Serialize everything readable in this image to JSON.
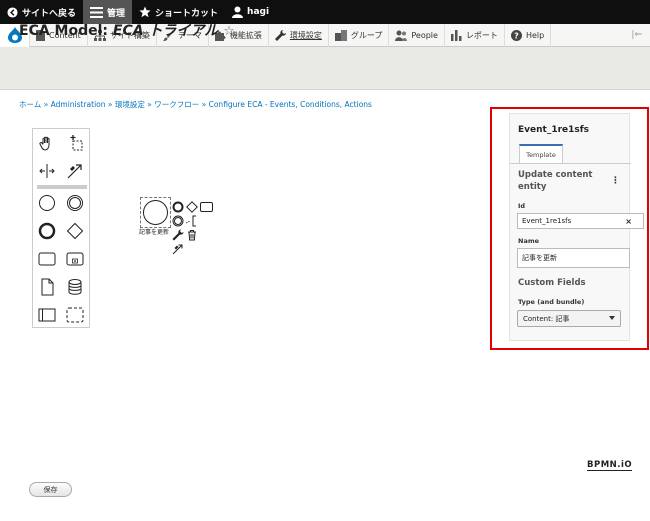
{
  "topbar": {
    "back_label": "サイトへ戻る",
    "manage_label": "管理",
    "shortcut_label": "ショートカット",
    "user_label": "hagi"
  },
  "toolbar": {
    "items": [
      {
        "label": "Content",
        "icon": "file-icon"
      },
      {
        "label": "サイト構築",
        "icon": "sitemap-icon"
      },
      {
        "label": "テーマ",
        "icon": "paintbrush-icon"
      },
      {
        "label": "機能拡張",
        "icon": "puzzle-icon"
      },
      {
        "label": "環境設定",
        "icon": "wrench-icon"
      },
      {
        "label": "グループ",
        "icon": "group-icon"
      },
      {
        "label": "People",
        "icon": "people-icon"
      },
      {
        "label": "レポート",
        "icon": "bar-chart-icon"
      },
      {
        "label": "Help",
        "icon": "help-icon"
      }
    ],
    "collapse_icon": "collapse-icon"
  },
  "page": {
    "title_prefix": "ECA Model: ",
    "title_name": "ECA トライアル",
    "star": "☆"
  },
  "breadcrumb": {
    "items": [
      "ホーム",
      "Administration",
      "環境設定",
      "ワークフロー",
      "Configure ECA - Events, Conditions, Actions"
    ],
    "separator": " » "
  },
  "canvas": {
    "shape_label": "記事を更新"
  },
  "properties": {
    "element_id": "Event_1re1sfs",
    "tab_label": "Template",
    "section_title": "Update content entity",
    "id_label": "Id",
    "id_value": "Event_1re1sfs",
    "clear_symbol": "×",
    "name_label": "Name",
    "name_value": "記事を更新",
    "custom_fields_title": "Custom Fields",
    "type_label": "Type (and bundle)",
    "type_value": "Content: 記事"
  },
  "bpmn_watermark": "BPMN.iO",
  "save_button": "保存",
  "colors": {
    "topbar_bg": "#0f0f0f",
    "link": "#0074bd",
    "highlight": "#e00000",
    "tab_accent": "#3c6eb4"
  }
}
